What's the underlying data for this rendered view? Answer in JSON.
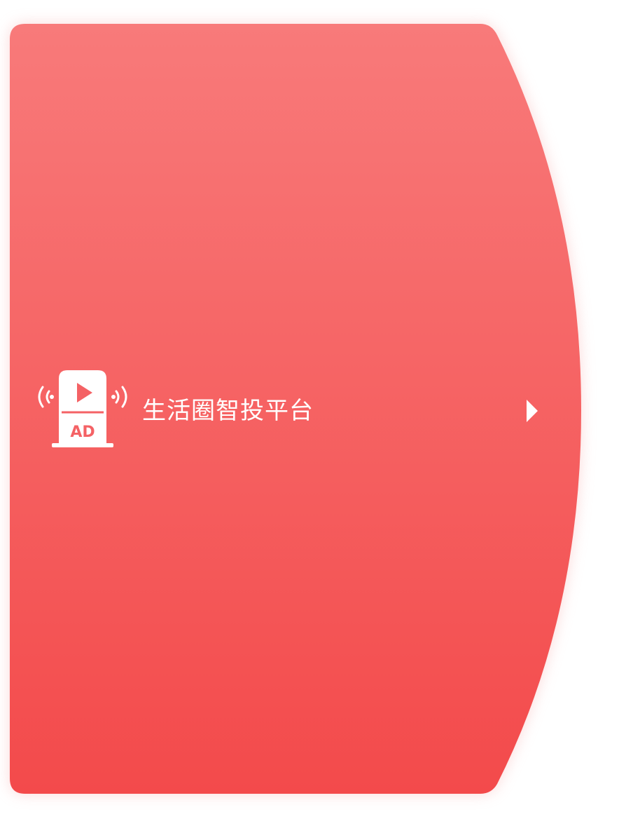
{
  "platform_card": {
    "title": "生活圈智投平台",
    "icon": "ad-broadcast-icon",
    "icon_badge": "AD",
    "arrow_icon": "chevron-right-icon",
    "colors": {
      "gradient_top": "#f87a7a",
      "gradient_bottom": "#f34a4b",
      "glow": "#f9b9b9",
      "foreground": "#ffffff"
    }
  }
}
